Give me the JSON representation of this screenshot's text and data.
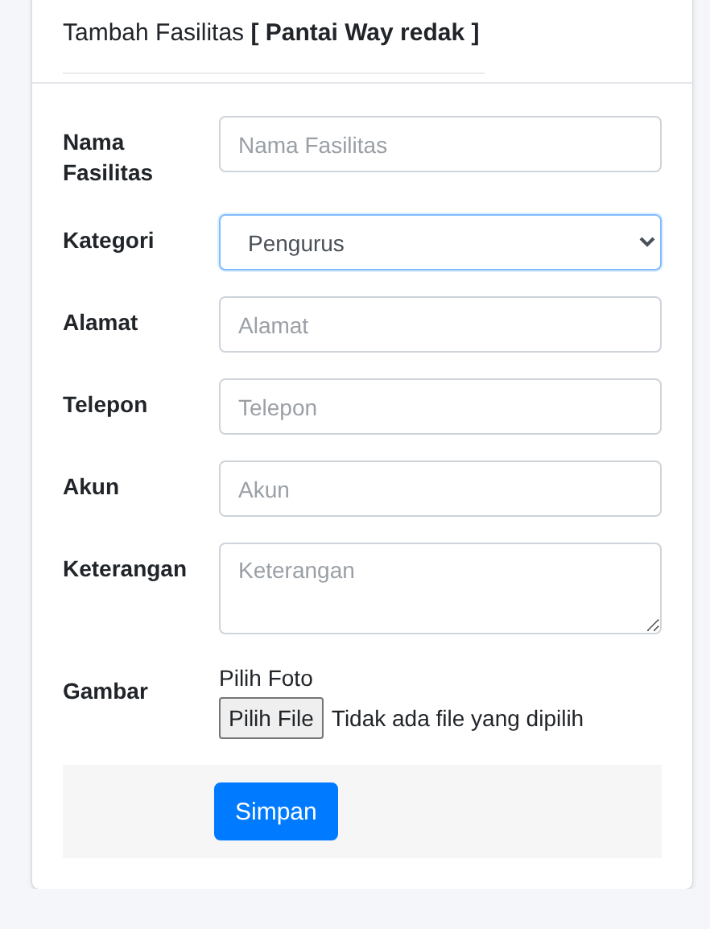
{
  "title": "Tambah Fasilitas **[ Pantai Way redak ]**",
  "fields": [
    {
      "kind": "input",
      "label": "Nama Fasilitas",
      "placeholder": "Nama Fasilitas"
    },
    {
      "kind": "select",
      "label": "Kategori",
      "value": "Pengurus",
      "focused": true
    },
    {
      "kind": "input",
      "label": "Alamat",
      "placeholder": "Alamat"
    },
    {
      "kind": "input",
      "label": "Telepon",
      "placeholder": "Telepon"
    },
    {
      "kind": "input",
      "label": "Akun",
      "placeholder": "Akun"
    },
    {
      "kind": "textarea",
      "label": "Keterangan",
      "placeholder": "Keterangan"
    },
    {
      "kind": "file",
      "label": "Gambar",
      "caption": "Pilih Foto",
      "button": "Pilih File",
      "status": "Tidak ada file yang dipilih"
    }
  ],
  "submit": "Simpan"
}
